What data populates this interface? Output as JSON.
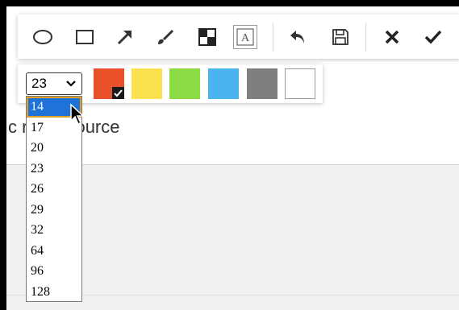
{
  "toolbar": {
    "tools": [
      {
        "name": "ellipse-tool",
        "icon": "circle-icon"
      },
      {
        "name": "rectangle-tool",
        "icon": "square-icon"
      },
      {
        "name": "arrow-tool",
        "icon": "arrow-icon"
      },
      {
        "name": "brush-tool",
        "icon": "brush-icon"
      },
      {
        "name": "mosaic-tool",
        "icon": "mosaic-icon"
      },
      {
        "name": "text-tool",
        "icon": "text-icon",
        "active": true
      },
      {
        "name": "undo-button",
        "icon": "undo-icon"
      },
      {
        "name": "save-button",
        "icon": "save-icon"
      },
      {
        "name": "cancel-button",
        "icon": "close-icon"
      },
      {
        "name": "confirm-button",
        "icon": "check-icon"
      }
    ],
    "text_tool_glyph": "A"
  },
  "font_size": {
    "selected": "23",
    "options": [
      "14",
      "17",
      "20",
      "23",
      "26",
      "29",
      "32",
      "64",
      "96",
      "128"
    ],
    "highlighted": "14"
  },
  "colors": {
    "swatches": [
      "#e8512a",
      "#fbe34f",
      "#8ddb44",
      "#4bb4ee",
      "#7f7f7f",
      "#ffffff"
    ],
    "selected_index": 0
  },
  "page": {
    "text_left": "c r",
    "text_right": "source",
    "bottom_text": "...",
    "bottom_link": ""
  }
}
